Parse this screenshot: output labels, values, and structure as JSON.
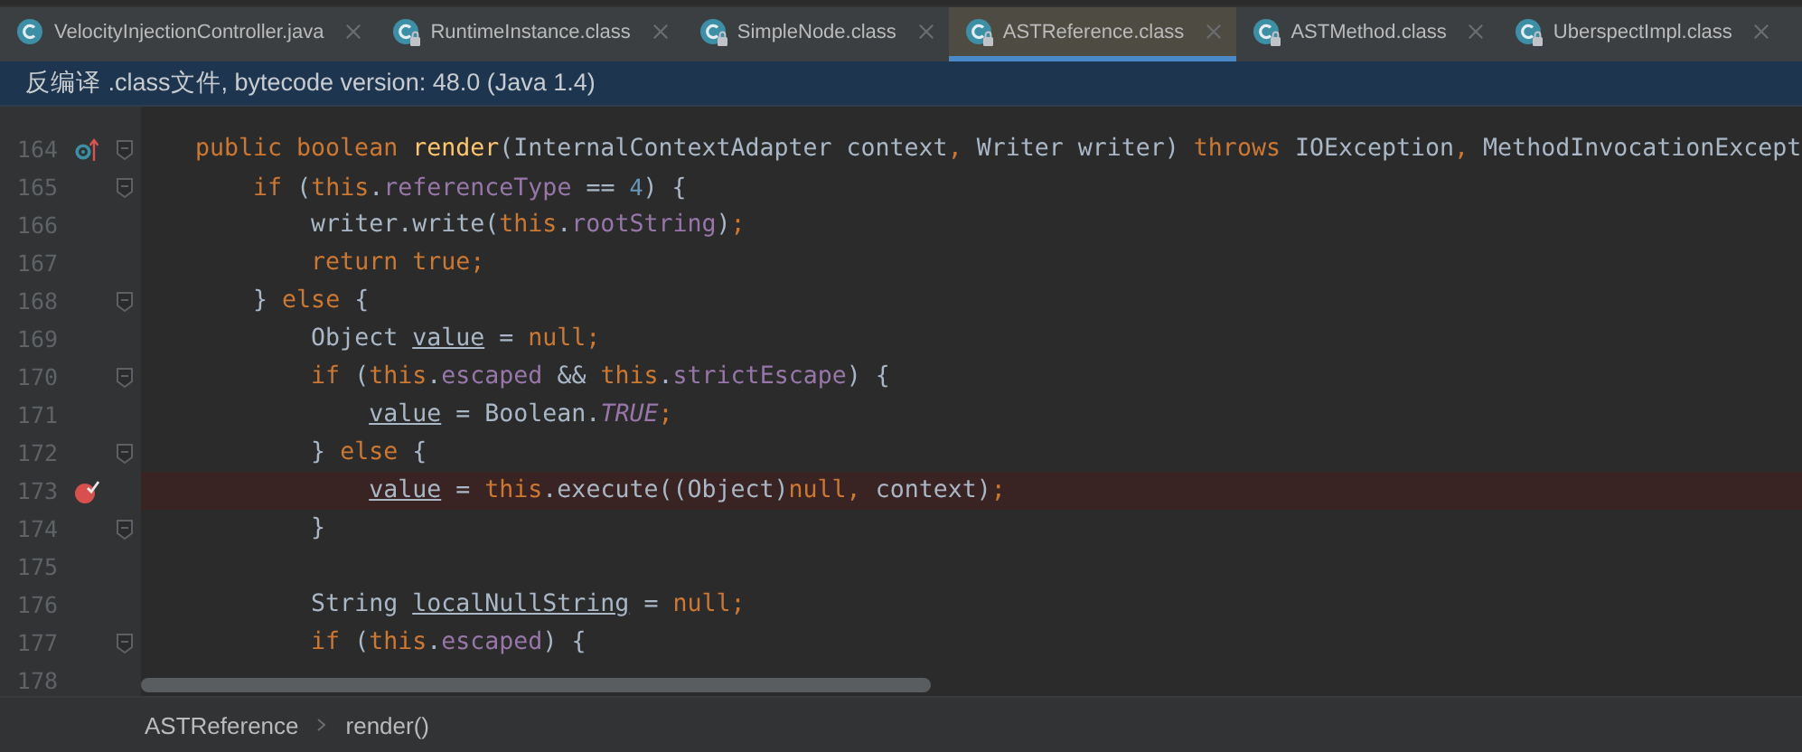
{
  "tabs": [
    {
      "label": "VelocityInjectionController.java",
      "locked": false,
      "selected": false
    },
    {
      "label": "RuntimeInstance.class",
      "locked": true,
      "selected": false
    },
    {
      "label": "SimpleNode.class",
      "locked": true,
      "selected": false
    },
    {
      "label": "ASTReference.class",
      "locked": true,
      "selected": true
    },
    {
      "label": "ASTMethod.class",
      "locked": true,
      "selected": false
    },
    {
      "label": "UberspectImpl.class",
      "locked": true,
      "selected": false
    }
  ],
  "banner": "反编译 .class文件, bytecode version: 48.0 (Java 1.4)",
  "lines": [
    {
      "number": "164",
      "gutter_icon": {
        "kind": "override"
      },
      "fold": true,
      "highlighted": false,
      "tokens": [
        {
          "kind": "kw",
          "t": "public boolean "
        },
        {
          "kind": "method",
          "t": "render"
        },
        {
          "kind": "plain",
          "t": "(InternalContextAdapter context"
        },
        {
          "kind": "kw",
          "t": ", "
        },
        {
          "kind": "plain",
          "t": "Writer writer) "
        },
        {
          "kind": "kw",
          "t": "throws "
        },
        {
          "kind": "plain",
          "t": "IOException"
        },
        {
          "kind": "kw",
          "t": ", "
        },
        {
          "kind": "plain",
          "t": "MethodInvocationExcept"
        }
      ]
    },
    {
      "number": "165",
      "fold": true,
      "highlighted": false,
      "tokens": [
        {
          "kind": "kw",
          "t": "    if "
        },
        {
          "kind": "plain",
          "t": "("
        },
        {
          "kind": "kw",
          "t": "this"
        },
        {
          "kind": "plain",
          "t": "."
        },
        {
          "kind": "field",
          "t": "referenceType"
        },
        {
          "kind": "plain",
          "t": " == "
        },
        {
          "kind": "num",
          "t": "4"
        },
        {
          "kind": "plain",
          "t": ") {"
        }
      ]
    },
    {
      "number": "166",
      "fold": false,
      "highlighted": false,
      "tokens": [
        {
          "kind": "plain",
          "t": "        writer.write("
        },
        {
          "kind": "kw",
          "t": "this"
        },
        {
          "kind": "plain",
          "t": "."
        },
        {
          "kind": "field",
          "t": "rootString"
        },
        {
          "kind": "plain",
          "t": ")"
        },
        {
          "kind": "kw",
          "t": ";"
        }
      ]
    },
    {
      "number": "167",
      "fold": false,
      "highlighted": false,
      "tokens": [
        {
          "kind": "kw",
          "t": "        return true;"
        }
      ]
    },
    {
      "number": "168",
      "fold": true,
      "highlighted": false,
      "tokens": [
        {
          "kind": "plain",
          "t": "    } "
        },
        {
          "kind": "kw",
          "t": "else "
        },
        {
          "kind": "plain",
          "t": "{"
        }
      ]
    },
    {
      "number": "169",
      "fold": false,
      "highlighted": false,
      "tokens": [
        {
          "kind": "plain",
          "t": "        Object "
        },
        {
          "kind": "local",
          "t": "value"
        },
        {
          "kind": "plain",
          "t": " = "
        },
        {
          "kind": "kw",
          "t": "null;"
        }
      ]
    },
    {
      "number": "170",
      "fold": true,
      "highlighted": false,
      "tokens": [
        {
          "kind": "kw",
          "t": "        if "
        },
        {
          "kind": "plain",
          "t": "("
        },
        {
          "kind": "kw",
          "t": "this"
        },
        {
          "kind": "plain",
          "t": "."
        },
        {
          "kind": "field",
          "t": "escaped"
        },
        {
          "kind": "plain",
          "t": " && "
        },
        {
          "kind": "kw",
          "t": "this"
        },
        {
          "kind": "plain",
          "t": "."
        },
        {
          "kind": "field",
          "t": "strictEscape"
        },
        {
          "kind": "plain",
          "t": ") {"
        }
      ]
    },
    {
      "number": "171",
      "fold": false,
      "highlighted": false,
      "tokens": [
        {
          "kind": "local",
          "t": "            value"
        },
        {
          "kind": "plain",
          "t": " = Boolean."
        },
        {
          "kind": "const",
          "t": "TRUE"
        },
        {
          "kind": "kw",
          "t": ";"
        }
      ]
    },
    {
      "number": "172",
      "fold": true,
      "highlighted": false,
      "tokens": [
        {
          "kind": "plain",
          "t": "        } "
        },
        {
          "kind": "kw",
          "t": "else "
        },
        {
          "kind": "plain",
          "t": "{"
        }
      ]
    },
    {
      "number": "173",
      "gutter_icon": {
        "kind": "breakpoint"
      },
      "fold": false,
      "highlighted": true,
      "tokens": [
        {
          "kind": "local",
          "t": "            value"
        },
        {
          "kind": "plain",
          "t": " = "
        },
        {
          "kind": "kw",
          "t": "this"
        },
        {
          "kind": "plain",
          "t": ".execute((Object)"
        },
        {
          "kind": "kw",
          "t": "null, "
        },
        {
          "kind": "plain",
          "t": "context)"
        },
        {
          "kind": "kw",
          "t": ";"
        }
      ]
    },
    {
      "number": "174",
      "fold": true,
      "highlighted": false,
      "tokens": [
        {
          "kind": "plain",
          "t": "        }"
        }
      ]
    },
    {
      "number": "175",
      "fold": false,
      "highlighted": false
    },
    {
      "number": "176",
      "fold": false,
      "highlighted": false,
      "tokens": [
        {
          "kind": "plain",
          "t": "        String "
        },
        {
          "kind": "local",
          "t": "localNullString"
        },
        {
          "kind": "plain",
          "t": " = "
        },
        {
          "kind": "kw",
          "t": "null;"
        }
      ]
    },
    {
      "number": "177",
      "fold": true,
      "highlighted": false,
      "tokens": [
        {
          "kind": "kw",
          "t": "        if "
        },
        {
          "kind": "plain",
          "t": "("
        },
        {
          "kind": "kw",
          "t": "this"
        },
        {
          "kind": "plain",
          "t": "."
        },
        {
          "kind": "field",
          "t": "escaped"
        },
        {
          "kind": "plain",
          "t": ") {"
        }
      ]
    },
    {
      "number": "178",
      "fold": false,
      "highlighted": false
    }
  ],
  "breadcrumbs": [
    "ASTReference",
    "render()"
  ]
}
